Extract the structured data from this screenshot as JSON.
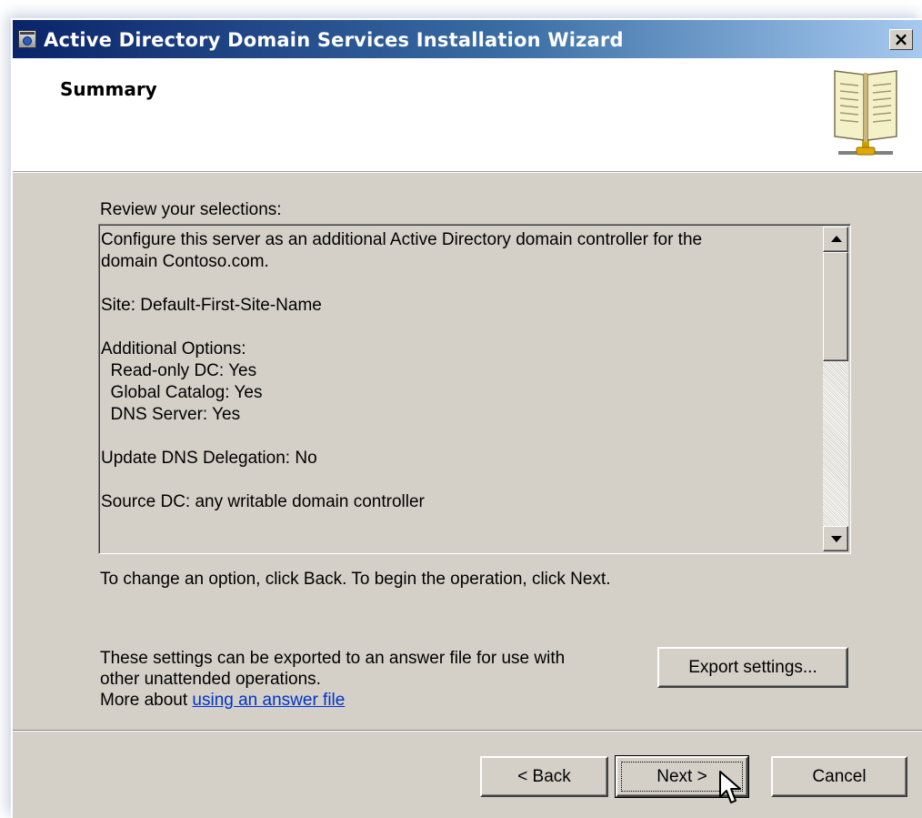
{
  "window": {
    "title": "Active Directory Domain Services Installation Wizard",
    "close_glyph": "×"
  },
  "header": {
    "page_title": "Summary",
    "icon": "book-network-icon"
  },
  "main": {
    "review_label": "Review your selections:",
    "summary_lines": [
      "Configure this server as an additional Active Directory domain controller for the",
      "domain Contoso.com.",
      "",
      "Site: Default-First-Site-Name",
      "",
      "Additional Options:",
      "  Read-only DC: Yes",
      "  Global Catalog: Yes",
      "  DNS Server: Yes",
      "",
      "Update DNS Delegation: No",
      "",
      "Source DC: any writable domain controller"
    ],
    "change_hint": "To change an option, click Back. To begin the operation, click Next.",
    "export_text_line1": "These settings can be exported to an answer file for use with",
    "export_text_line2": "other unattended operations.",
    "more_about_prefix": "More about ",
    "answer_link": "using an answer file",
    "export_button": "Export settings..."
  },
  "footer": {
    "back_button": "< Back",
    "next_button": "Next >",
    "cancel_button": "Cancel"
  },
  "colors": {
    "titlebar_start": "#0a246a",
    "titlebar_end": "#a6caf0",
    "dialog_face": "#d4d0c8",
    "link": "#0033cc"
  }
}
